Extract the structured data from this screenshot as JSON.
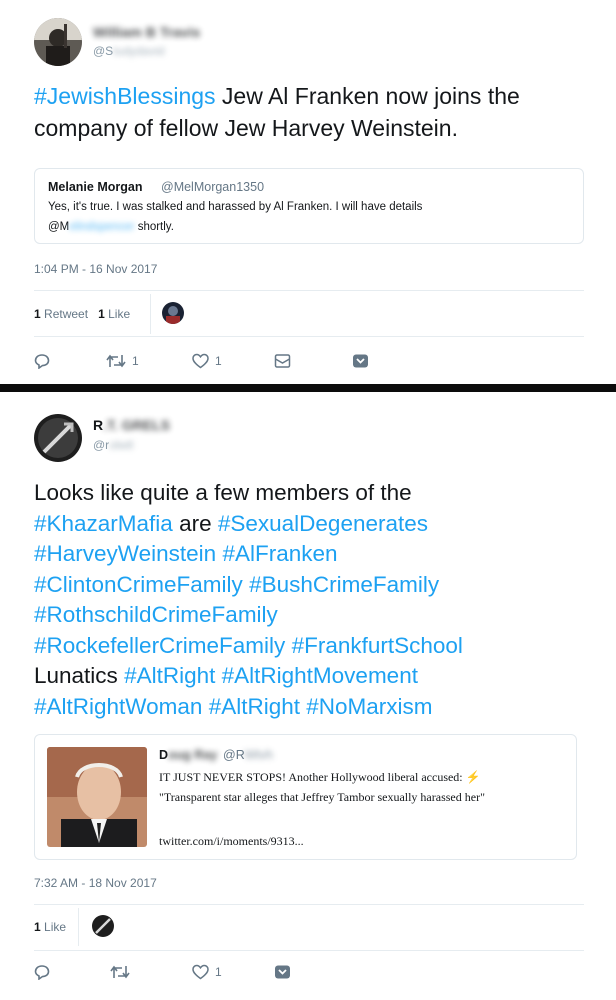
{
  "tweet1": {
    "name": "William B Travis",
    "handle": "@S",
    "body": {
      "hashtag": "#JewishBlessings",
      "text": " Jew Al Franken now joins the company of fellow Jew Harvey Weinstein."
    },
    "quote": {
      "name": "Melanie Morgan",
      "handle": "@MelMorgan1350",
      "line1": "Yes, it's true. I was stalked and harassed by Al Franken. I will have details",
      "mention": "@M",
      "line2_end": "shortly."
    },
    "timestamp": "1:04 PM - 16 Nov 2017",
    "retweets_count": "1",
    "retweets_label": "Retweet",
    "likes_count": "1",
    "likes_label": "Like",
    "action_retweet_count": "1",
    "action_like_count": "1"
  },
  "tweet2": {
    "name": "R",
    "handle": "@r",
    "body": {
      "lead": "Looks like quite a few members of the",
      "h1": "#KhazarMafia",
      "are": " are ",
      "h2": "#SexualDegenerates",
      "h3": "#HarveyWeinstein",
      "h4": "#AlFranken",
      "h5": "#ClintonCrimeFamily",
      "h6": "#BushCrimeFamily",
      "h7": "#RothschildCrimeFamily",
      "h8": "#RockefellerCrimeFamily",
      "h9": "#FrankfurtSchool",
      "lunatics": "Lunatics ",
      "h10": "#AltRight",
      "h11": "#AltRightMovement",
      "h12": "#AltRightWoman",
      "h13": "#AltRight",
      "h14": "#NoMarxism"
    },
    "quote": {
      "name": "D",
      "handle": "@R",
      "line1": "IT JUST NEVER STOPS! Another Hollywood liberal accused: ⚡",
      "line2": "\"Transparent star alleges that Jeffrey Tambor sexually harassed her\"",
      "link": "twitter.com/i/moments/9313..."
    },
    "timestamp": "7:32 AM - 18 Nov 2017",
    "likes_count": "1",
    "likes_label": "Like",
    "action_like_count": "1"
  },
  "colors": {
    "hashtag": "#1da1f2",
    "muted": "#657786",
    "divider": "#0c0c0c"
  }
}
